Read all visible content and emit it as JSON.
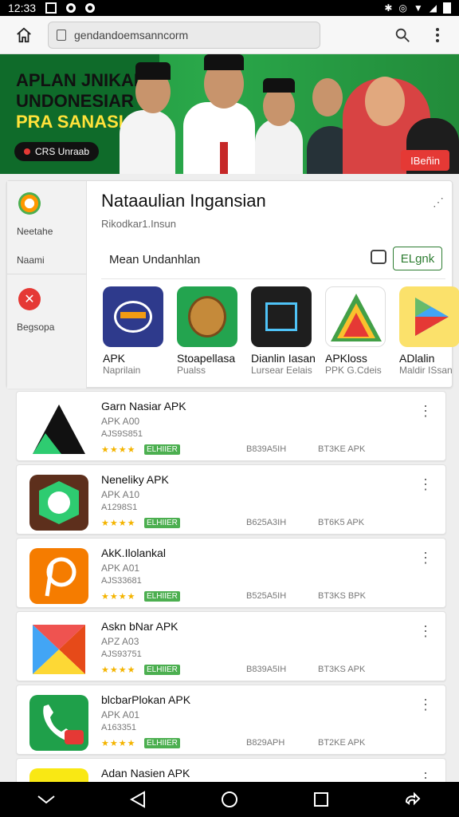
{
  "status_bar": {
    "time": "12:33"
  },
  "toolbar": {
    "url": "gendandoemsanncorm"
  },
  "banner": {
    "line1": "APLAN JNIKAN",
    "line2": "UNDONESIAR",
    "line3": "PRA SANASIAI",
    "pill_left": "CRS Unraab",
    "pill_right": "IBeñin"
  },
  "card": {
    "title": "Nataaulian Ingansian",
    "subtitle": "Rikodkar1.Insun",
    "section": "Mean Undanhlan",
    "button": "ELgnk",
    "sidebar": [
      {
        "label": "Neetahe",
        "icon": "green-circle-icon"
      },
      {
        "label": "Naami",
        "icon": ""
      },
      {
        "label": "Begsopa",
        "icon": "red-x-icon"
      }
    ],
    "apps": [
      {
        "name": "APK",
        "dev": "Naprilain",
        "icon": "apk-blue-icon",
        "color": "#2e3a8c"
      },
      {
        "name": "Stoapellasa",
        "dev": "Pualss",
        "icon": "green-shield-icon",
        "color": "#23a44f"
      },
      {
        "name": "Dianlin Iasan",
        "dev": "Lursear Eelais",
        "icon": "dark-bolt-icon",
        "color": "#1e1e1e"
      },
      {
        "name": "APKloss",
        "dev": "PPK G.Cdeis",
        "icon": "triangle-gpi-icon",
        "color": "#ffffff"
      },
      {
        "name": "ADlalin",
        "dev": "Maldir ISsan",
        "icon": "play-triangle-icon",
        "color": "#fbe16b"
      }
    ]
  },
  "list": [
    {
      "title": "Garn Nasiar APK",
      "sub": "APK A00",
      "num": "AJS9S851",
      "stars": "★★★★",
      "badge": "ELHIIER",
      "size": "B839A5IH",
      "type": "BT3KE APK",
      "icon": "black-a-icon"
    },
    {
      "title": "Neneliky APK",
      "sub": "APK A10",
      "num": "A1298S1",
      "stars": "★★★★",
      "badge": "ELHIIER",
      "size": "B625A3IH",
      "type": "BT6K5 APK",
      "icon": "green-hex-icon"
    },
    {
      "title": "AkK.Ilolankal",
      "sub": "APK A01",
      "num": "AJS33681",
      "stars": "★★★★",
      "badge": "ELHIIER",
      "size": "B525A5IH",
      "type": "BT3KS BPK",
      "icon": "orange-p-icon"
    },
    {
      "title": "Askn bNar APK",
      "sub": "APZ A03",
      "num": "AJS93751",
      "stars": "★★★★",
      "badge": "ELHIIER",
      "size": "B839A5IH",
      "type": "BT3KS APK",
      "icon": "colored-x-icon"
    },
    {
      "title": "blcbarPlokan APK",
      "sub": "APK A01",
      "num": "A163351",
      "stars": "★★★★",
      "badge": "ELHIIER",
      "size": "B829APH",
      "type": "BT2KE APK",
      "icon": "phone-icon"
    },
    {
      "title": "Adan Nasien APK",
      "sub": "",
      "num": "",
      "stars": "",
      "badge": "",
      "size": "",
      "type": "",
      "icon": "yellow-icon"
    }
  ]
}
